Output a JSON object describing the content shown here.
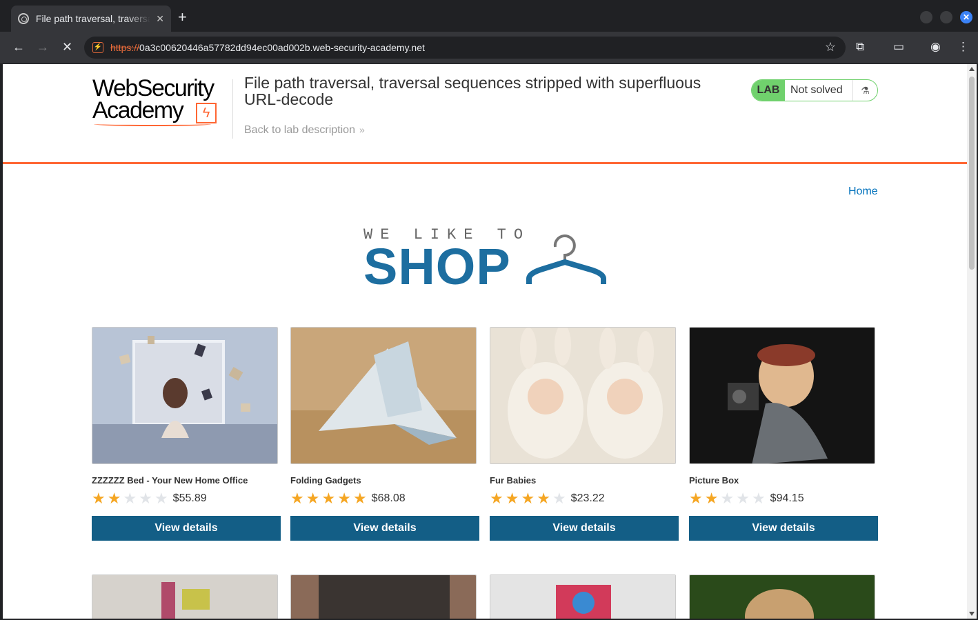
{
  "browser": {
    "tab_title": "File path traversal, traversal sequences stripped with superfluous URL-decode",
    "url_scheme": "https://",
    "url_host": "0a3c00620446a57782dd94ec00ad002b.web-security-academy.net"
  },
  "academy": {
    "logo_line1": "WebSecurity",
    "logo_line2": "Academy",
    "lab_title": "File path traversal, traversal sequences stripped with superfluous URL-decode",
    "back_link": "Back to lab description",
    "lab_badge": "LAB",
    "lab_status": "Not solved"
  },
  "shop": {
    "home_link": "Home",
    "hero_small": "WE LIKE TO",
    "hero_big": "SHOP",
    "products": [
      {
        "name": "ZZZZZZ Bed - Your New Home Office",
        "rating": 2,
        "price": "$55.89",
        "button": "View details",
        "image": "woman-books"
      },
      {
        "name": "Folding Gadgets",
        "rating": 5,
        "price": "$68.08",
        "button": "View details",
        "image": "origami-banknote"
      },
      {
        "name": "Fur Babies",
        "rating": 4,
        "price": "$23.22",
        "button": "View details",
        "image": "babies-bunny-hats"
      },
      {
        "name": "Picture Box",
        "rating": 2,
        "price": "$94.15",
        "button": "View details",
        "image": "man-camera-figurine"
      }
    ]
  },
  "colors": {
    "accent": "#ff6633",
    "button": "#135e86",
    "star_on": "#f5a623",
    "star_off": "#e1e4e8",
    "lab_green": "#70d16d",
    "link": "#0071bc"
  }
}
